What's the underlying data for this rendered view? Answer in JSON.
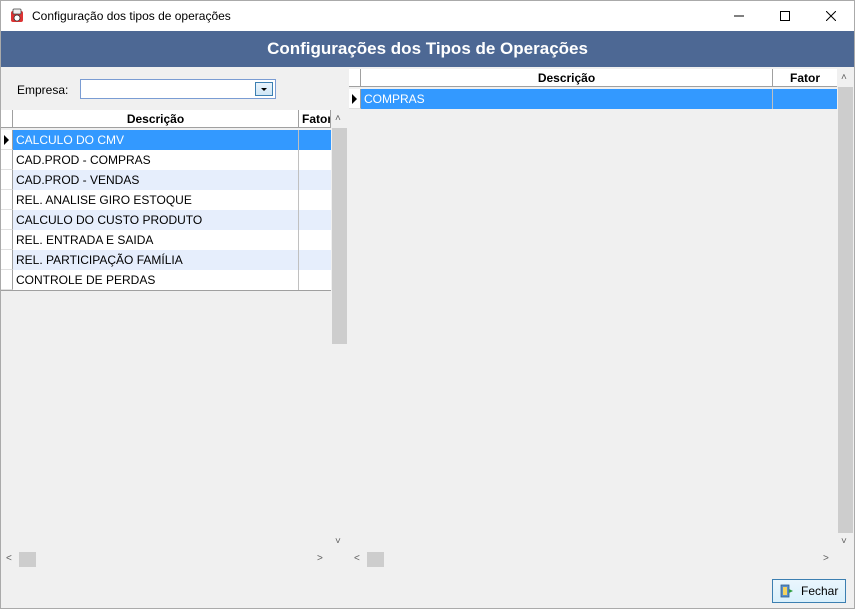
{
  "window": {
    "title": "Configuração dos tipos de operações",
    "header": "Configurações dos Tipos de Operações"
  },
  "empresa": {
    "label": "Empresa:",
    "value": ""
  },
  "left_grid": {
    "columns": [
      "Descrição",
      "Fator"
    ],
    "rows": [
      "CALCULO DO CMV",
      "CAD.PROD - COMPRAS",
      "CAD.PROD - VENDAS",
      "REL. ANALISE GIRO ESTOQUE",
      "CALCULO DO CUSTO PRODUTO",
      "REL. ENTRADA E SAIDA",
      "REL. PARTICIPAÇÃO FAMÍLIA",
      "CONTROLE DE PERDAS"
    ]
  },
  "right_grid": {
    "columns": [
      "Descrição",
      "Fator"
    ],
    "rows": [
      "COMPRAS"
    ]
  },
  "buttons": {
    "close": "Fechar"
  },
  "colors": {
    "header_band": "#4d6894",
    "selection": "#3399ff",
    "alt_row": "#e6eefc"
  }
}
